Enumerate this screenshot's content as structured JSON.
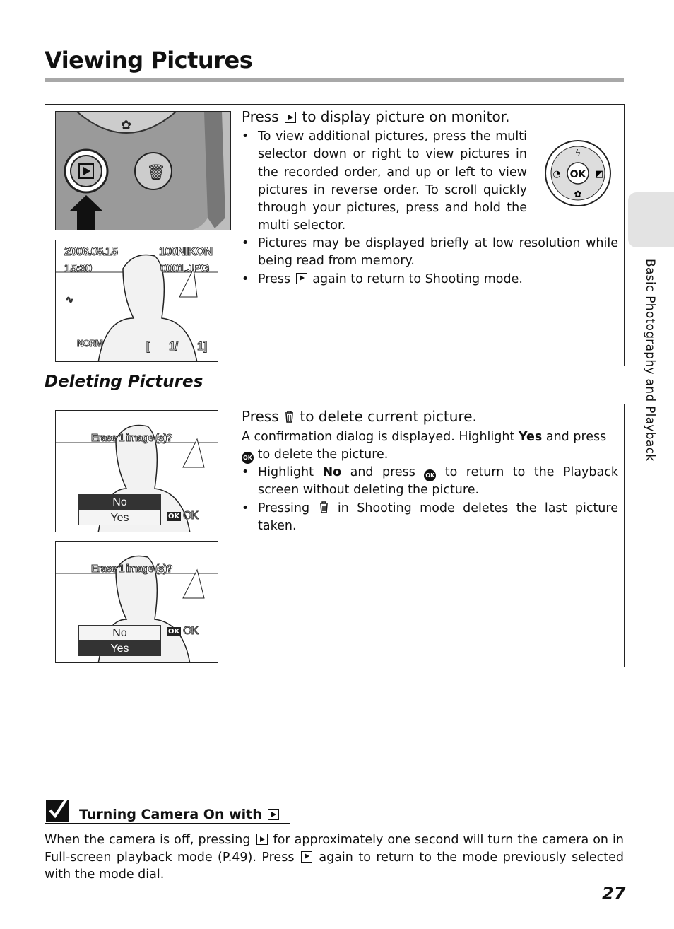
{
  "page": {
    "title": "Viewing Pictures",
    "section_tab": "Basic Photography and Playback",
    "page_number": "27"
  },
  "viewing": {
    "heading_pre": "Press",
    "heading_post": "to display picture on monitor.",
    "bullets": [
      "To view additional pictures, press the multi selector down or right to view pictures in the recorded order, and up or left to view pictures in reverse order. To scroll quickly through your pictures, press and hold the multi selector.",
      "Pictures may be displayed briefly at low resolution while being read from memory."
    ],
    "bullet3_pre": "Press",
    "bullet3_post": "again to return to Shooting mode.",
    "multiselector_center": "OK",
    "lcd": {
      "date": "2006.05.15",
      "time": "15:30",
      "folder": "100NIKON",
      "file": "0001.JPG",
      "quality": "NORM",
      "counter_open": "[",
      "counter": "1/",
      "total": "1]"
    }
  },
  "deleting": {
    "title": "Deleting Pictures",
    "heading_pre": "Press",
    "heading_post": "to delete current picture.",
    "intro_pre": "A confirmation dialog is displayed. Highlight",
    "intro_bold": "Yes",
    "intro_mid": "and press",
    "intro_post": "to delete the picture.",
    "b1_pre": "Highlight",
    "b1_bold": "No",
    "b1_mid": "and press",
    "b1_post": "to return to the Playback screen without deleting the picture.",
    "b2_pre": "Pressing",
    "b2_post": "in Shooting mode deletes the last picture taken.",
    "dialog": {
      "prompt": "Erase 1 image (s)?",
      "no": "No",
      "yes": "Yes",
      "ok_key": "OK",
      "ok_label": "OK"
    }
  },
  "tip": {
    "heading": "Turning Camera On with",
    "text_pre": "When the camera is off, pressing",
    "text_mid": "for approximately one second will turn the camera on in Full-screen playback mode (P.49). Press",
    "text_post": "again to return to the mode previously selected with the mode dial."
  }
}
